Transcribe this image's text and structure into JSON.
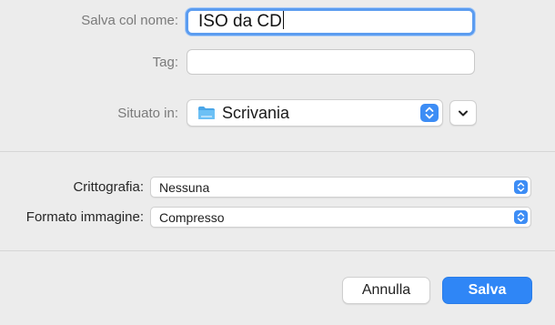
{
  "form": {
    "name_label": "Salva col nome:",
    "name_value": "ISO da CD",
    "tag_label": "Tag:",
    "tag_value": "",
    "location_label": "Situato in:",
    "location_value": "Scrivania",
    "location_icon": "folder-icon"
  },
  "options": {
    "encryption_label": "Crittografia:",
    "encryption_value": "Nessuna",
    "format_label": "Formato immagine:",
    "format_value": "Compresso"
  },
  "buttons": {
    "cancel_label": "Annulla",
    "save_label": "Salva"
  },
  "colors": {
    "accent": "#2f86f6",
    "focus_ring": "#5b9cf0",
    "background": "#ececec"
  }
}
